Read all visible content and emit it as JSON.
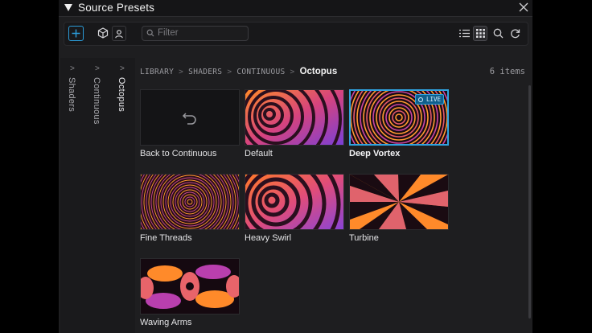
{
  "window": {
    "title": "Source Presets"
  },
  "toolbar": {
    "filter_placeholder": "Filter",
    "accent_color": "#2b9bd8",
    "icons": [
      "plus-icon",
      "cube-icon",
      "user-icon",
      "search-icon",
      "list-view-icon",
      "grid-view-icon",
      "search-icon",
      "refresh-icon"
    ]
  },
  "columns": [
    {
      "label": "Shaders",
      "active": false
    },
    {
      "label": "Continuous",
      "active": false
    },
    {
      "label": "Octopus",
      "active": true
    }
  ],
  "breadcrumb": {
    "items": [
      "LIBRARY",
      "SHADERS",
      "CONTINUOUS"
    ],
    "current": "Octopus"
  },
  "count_label": "6 items",
  "tiles": [
    {
      "label": "Back to Continuous",
      "kind": "back"
    },
    {
      "label": "Default",
      "kind": "swirl"
    },
    {
      "label": "Deep Vortex",
      "kind": "vortex",
      "selected": true,
      "badge": "LIVE"
    },
    {
      "label": "Fine Threads",
      "kind": "threads"
    },
    {
      "label": "Heavy Swirl",
      "kind": "swirl"
    },
    {
      "label": "Turbine",
      "kind": "turbine"
    },
    {
      "label": "Waving Arms",
      "kind": "arms"
    }
  ]
}
